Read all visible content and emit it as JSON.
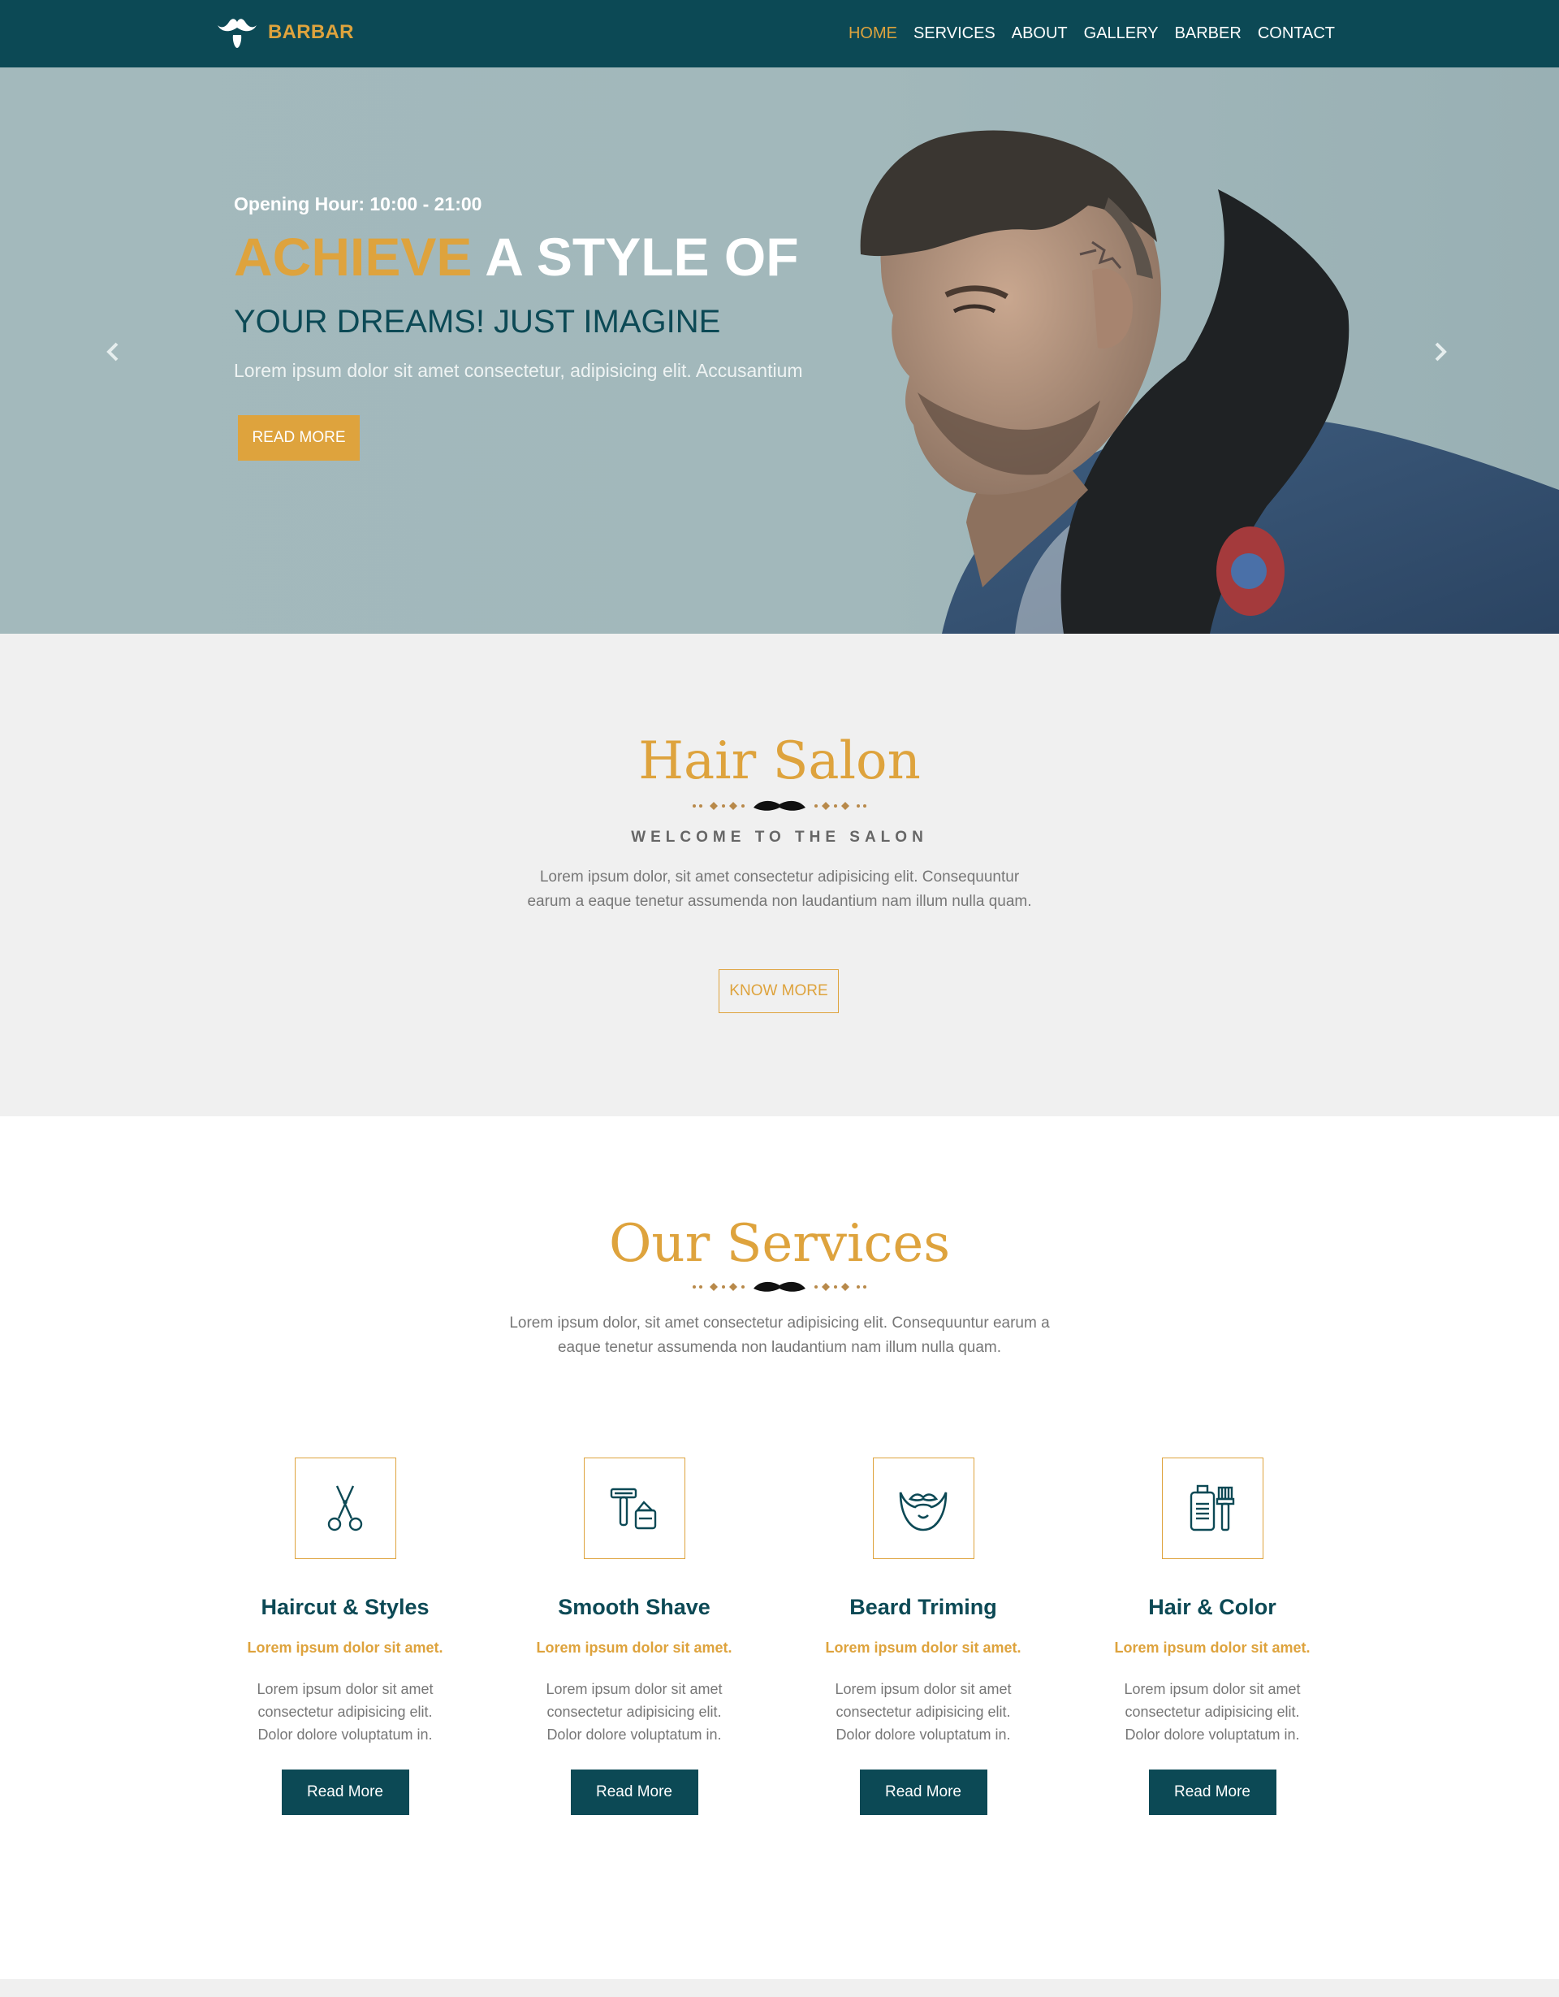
{
  "navbar": {
    "logo_text": "BARBAR",
    "links": [
      "HOME",
      "SERVICES",
      "ABOUT",
      "GALLERY",
      "BARBER",
      "CONTACT"
    ],
    "active_link": "HOME"
  },
  "hero": {
    "hours": "Opening Hour: 10:00 - 21:00",
    "headline_accent": "ACHIEVE",
    "headline_rest": "A STYLE OF",
    "subheadline": "YOUR DREAMS! JUST IMAGINE",
    "text": "Lorem ipsum dolor sit amet consectetur, adipisicing elit. Accusantium",
    "button": "READ MORE",
    "image": "man-portrait"
  },
  "about": {
    "title": "Hair Salon",
    "subtitle": "WELCOME TO THE SALON",
    "text": "Lorem ipsum dolor, sit amet consectetur adipisicing elit. Consequuntur earum a eaque tenetur assumenda non laudantium nam illum nulla quam.",
    "button": "KNOW MORE"
  },
  "services": {
    "title": "Our Services",
    "text": "Lorem ipsum dolor, sit amet consectetur adipisicing elit. Consequuntur earum a eaque tenetur assumenda non laudantium nam illum nulla quam.",
    "cards": [
      {
        "title": "Haircut & Styles",
        "subtitle": "Lorem ipsum dolor sit amet.",
        "text": "Lorem ipsum dolor sit amet consectetur adipisicing elit. Dolor dolore voluptatum in.",
        "button": "Read More",
        "icon": "scissors-icon"
      },
      {
        "title": "Smooth Shave",
        "subtitle": "Lorem ipsum dolor sit amet.",
        "text": "Lorem ipsum dolor sit amet consectetur adipisicing elit. Dolor dolore voluptatum in.",
        "button": "Read More",
        "icon": "razor-icon"
      },
      {
        "title": "Beard Triming",
        "subtitle": "Lorem ipsum dolor sit amet.",
        "text": "Lorem ipsum dolor sit amet consectetur adipisicing elit. Dolor dolore voluptatum in.",
        "button": "Read More",
        "icon": "beard-icon"
      },
      {
        "title": "Hair & Color",
        "subtitle": "Lorem ipsum dolor sit amet.",
        "text": "Lorem ipsum dolor sit amet consectetur adipisicing elit. Dolor dolore voluptatum in.",
        "button": "Read More",
        "icon": "hair-color-icon"
      }
    ]
  },
  "colors": {
    "primary": "#0c4955",
    "accent": "#dea33d",
    "light_bg": "#f0f0f0",
    "hero_bg": "#a3b9bc"
  }
}
